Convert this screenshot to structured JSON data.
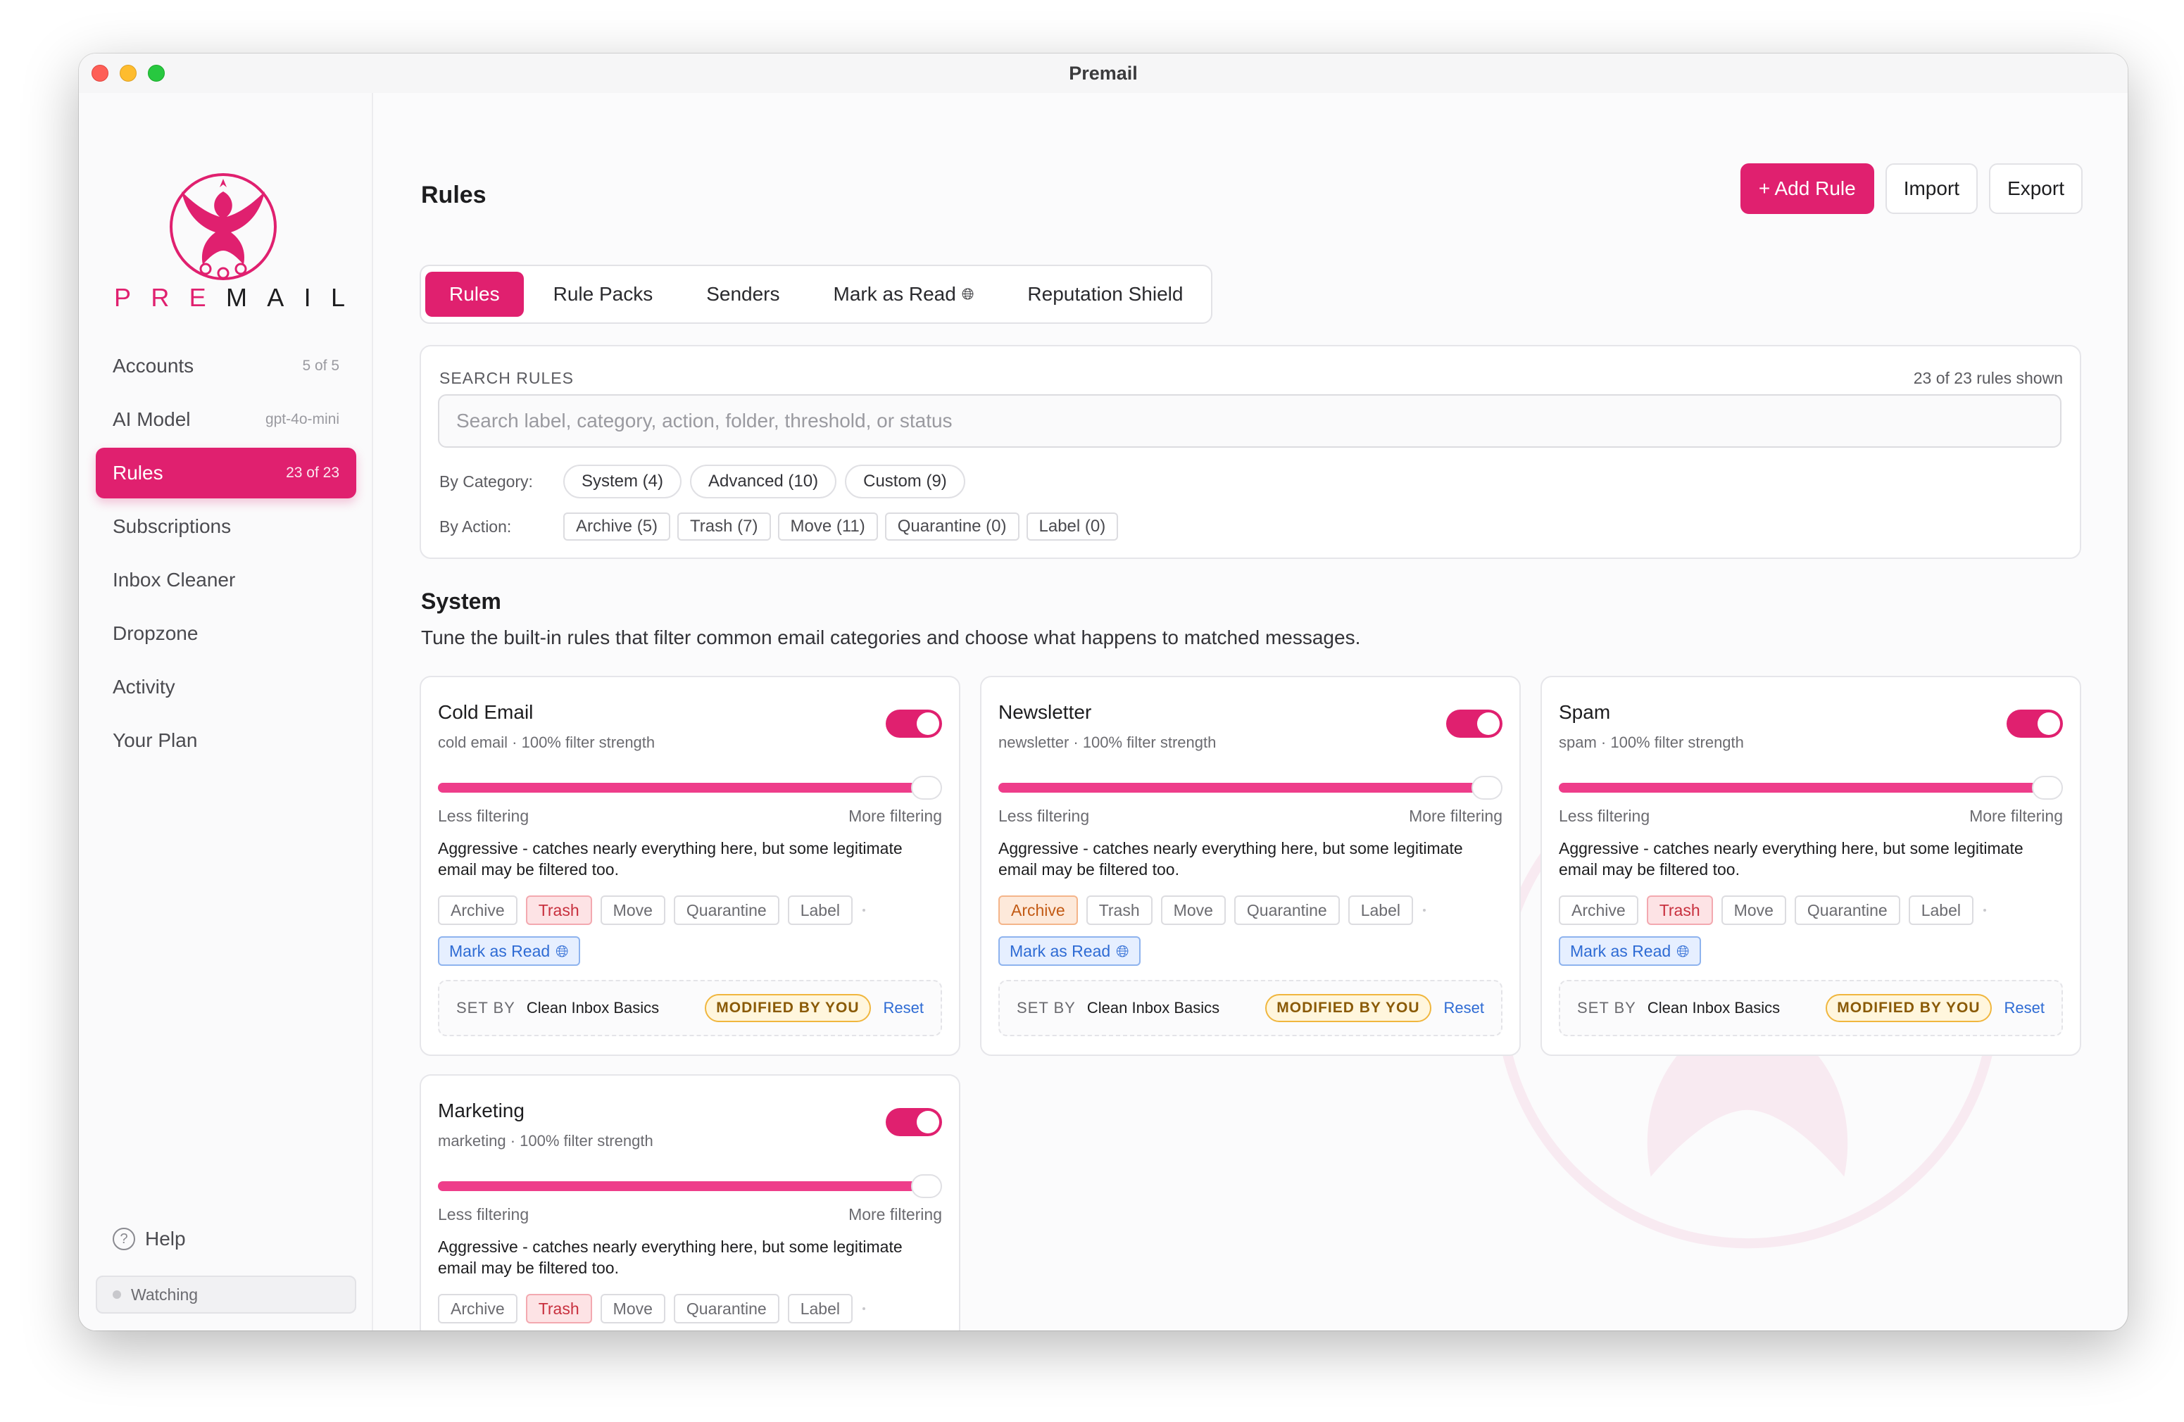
{
  "window": {
    "title": "Premail"
  },
  "brand": {
    "letters": [
      "P",
      "R",
      "E",
      "M",
      "A",
      "I",
      "L"
    ]
  },
  "sidebar": {
    "items": [
      {
        "label": "Accounts",
        "meta": "5 of 5"
      },
      {
        "label": "AI Model",
        "meta": "gpt-4o-mini"
      },
      {
        "label": "Rules",
        "meta": "23 of 23",
        "active": true
      },
      {
        "label": "Subscriptions",
        "meta": ""
      },
      {
        "label": "Inbox Cleaner",
        "meta": ""
      },
      {
        "label": "Dropzone",
        "meta": ""
      },
      {
        "label": "Activity",
        "meta": ""
      },
      {
        "label": "Your Plan",
        "meta": ""
      }
    ],
    "help_label": "Help",
    "status_label": "Watching"
  },
  "header": {
    "title": "Rules",
    "add_label": "+ Add Rule",
    "import_label": "Import",
    "export_label": "Export"
  },
  "tabs": [
    {
      "label": "Rules",
      "active": true
    },
    {
      "label": "Rule Packs"
    },
    {
      "label": "Senders"
    },
    {
      "label": "Mark as Read",
      "icon": "globe-icon"
    },
    {
      "label": "Reputation Shield"
    }
  ],
  "search": {
    "label": "SEARCH RULES",
    "count": "23 of 23 rules shown",
    "placeholder": "Search label, category, action, folder, threshold, or status",
    "category_label": "By Category:",
    "categories": [
      "System (4)",
      "Advanced (10)",
      "Custom (9)"
    ],
    "action_label": "By Action:",
    "actions": [
      "Archive (5)",
      "Trash (7)",
      "Move (11)",
      "Quarantine (0)",
      "Label (0)"
    ]
  },
  "section": {
    "title": "System",
    "description": "Tune the built-in rules that filter common email categories and choose what happens to matched messages."
  },
  "labels": {
    "less": "Less filtering",
    "more": "More filtering",
    "set_by": "SET BY",
    "modified": "MODIFIED BY YOU",
    "reset": "Reset",
    "mark_read": "Mark as Read",
    "actions": [
      "Archive",
      "Trash",
      "Move",
      "Quarantine",
      "Label"
    ]
  },
  "accent": "#e0206f",
  "cards": [
    {
      "title": "Cold Email",
      "subtitle": "cold email · 100% filter strength",
      "strength": 1.0,
      "enabled": true,
      "description": "Aggressive - catches nearly everything here, but some legitimate email may be filtered too.",
      "selected_action": "Trash",
      "set_by": "Clean Inbox Basics"
    },
    {
      "title": "Newsletter",
      "subtitle": "newsletter · 100% filter strength",
      "strength": 1.0,
      "enabled": true,
      "description": "Aggressive - catches nearly everything here, but some legitimate email may be filtered too.",
      "selected_action": "Archive",
      "set_by": "Clean Inbox Basics"
    },
    {
      "title": "Spam",
      "subtitle": "spam · 100% filter strength",
      "strength": 1.0,
      "enabled": true,
      "description": "Aggressive - catches nearly everything here, but some legitimate email may be filtered too.",
      "selected_action": "Trash",
      "set_by": "Clean Inbox Basics"
    },
    {
      "title": "Marketing",
      "subtitle": "marketing · 100% filter strength",
      "strength": 1.0,
      "enabled": true,
      "description": "Aggressive - catches nearly everything here, but some legitimate email may be filtered too.",
      "selected_action": "Trash",
      "set_by": ""
    }
  ]
}
